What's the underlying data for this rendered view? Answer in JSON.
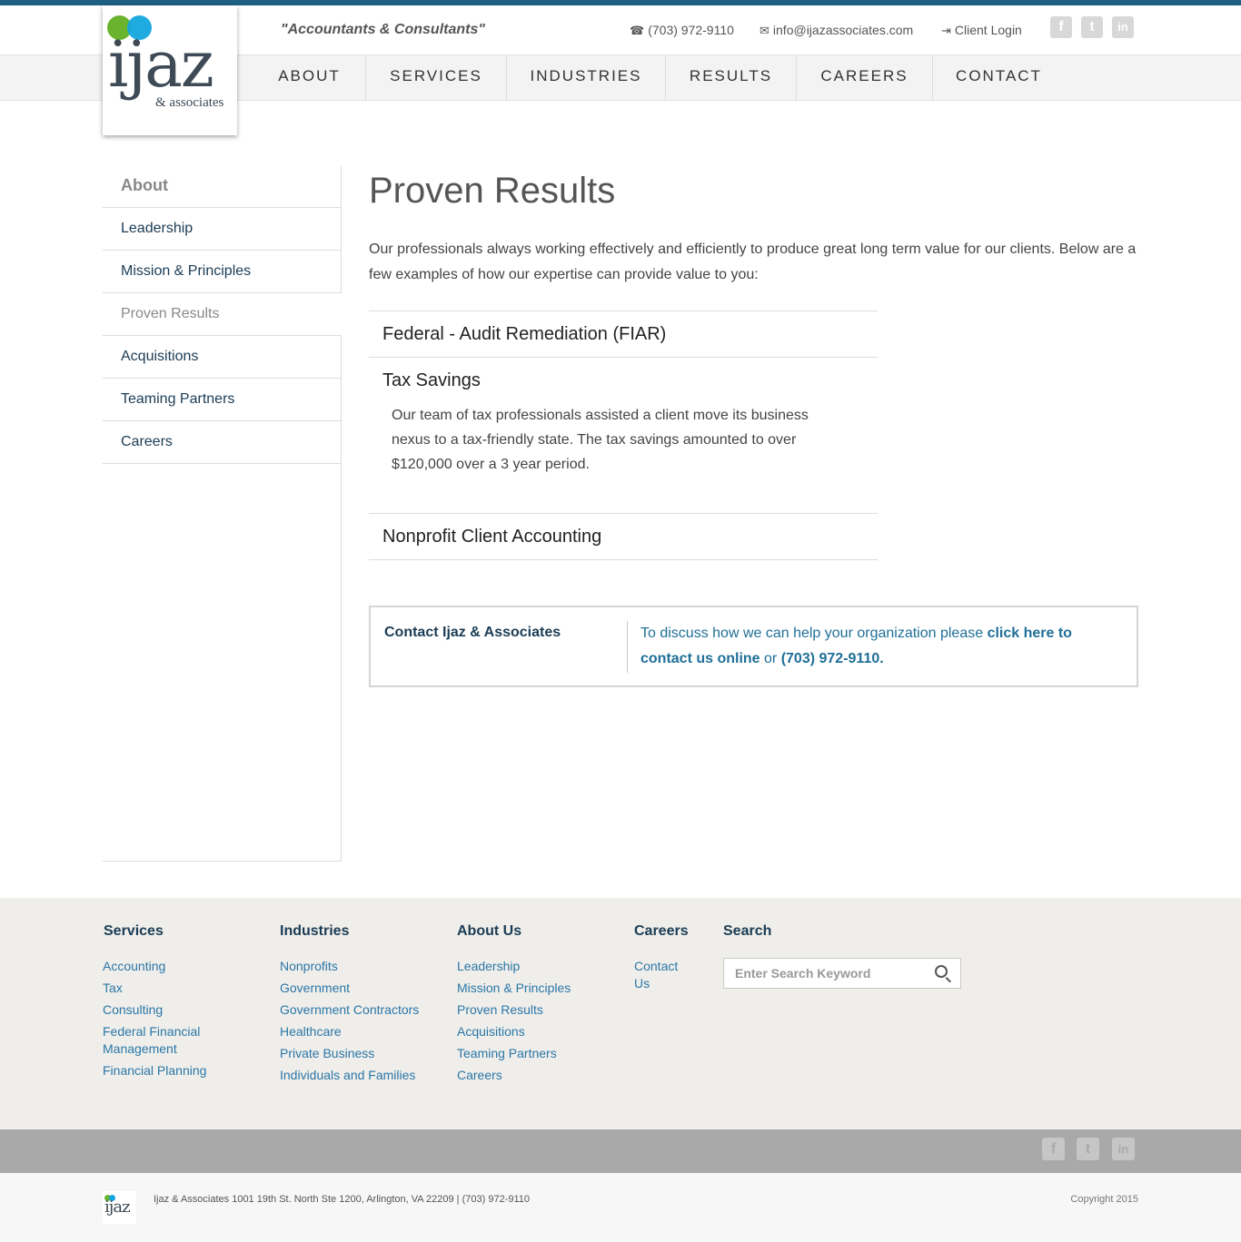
{
  "header": {
    "tagline": "\"Accountants & Consultants\"",
    "phone": "(703) 972-9110",
    "email": "info@ijazassociates.com",
    "client_login": "Client Login",
    "logo_word": "ijaz",
    "logo_sub": "& associates",
    "social": [
      "f",
      "t",
      "in"
    ]
  },
  "nav": [
    "ABOUT",
    "SERVICES",
    "INDUSTRIES",
    "RESULTS",
    "CAREERS",
    "CONTACT"
  ],
  "sidebar": {
    "title": "About",
    "items": [
      {
        "label": "Leadership"
      },
      {
        "label": "Mission & Principles"
      },
      {
        "label": "Proven Results"
      },
      {
        "label": "Acquisitions"
      },
      {
        "label": "Teaming Partners"
      },
      {
        "label": "Careers"
      }
    ]
  },
  "main": {
    "title": "Proven Results",
    "intro": "Our professionals always working effectively and efficiently to produce great long term value for our clients. Below are a few examples of how our expertise can provide value to you:",
    "accordion": [
      {
        "title": "Federal - Audit Remediation (FIAR)"
      },
      {
        "title": "Tax Savings",
        "body": "Our team of tax professionals assisted a client move its business nexus to a tax-friendly state. The tax savings amounted to over $120,000 over a 3 year period."
      },
      {
        "title": "Nonprofit Client Accounting"
      }
    ]
  },
  "cta": {
    "heading": "Contact Ijaz & Associates",
    "text_pre": "To discuss how we can help your organization please ",
    "link": "click here to contact us online",
    "text_mid": " or ",
    "phone": "(703) 972-9110."
  },
  "footer": {
    "services": {
      "title": "Services",
      "links": [
        "Accounting",
        "Tax",
        "Consulting",
        "Federal Financial Management",
        "Financial Planning"
      ]
    },
    "industries": {
      "title": "Industries",
      "links": [
        "Nonprofits",
        "Government",
        "Government Contractors",
        "Healthcare",
        "Private Business",
        "Individuals and Families"
      ]
    },
    "about": {
      "title": "About Us",
      "links": [
        "Leadership",
        "Mission & Principles",
        "Proven Results",
        "Acquisitions",
        "Teaming Partners",
        "Careers"
      ]
    },
    "careers": {
      "title": "Careers",
      "links": [
        "Contact Us"
      ]
    },
    "search": {
      "title": "Search",
      "placeholder": "Enter Search Keyword"
    }
  },
  "bottom": {
    "address": "Ijaz & Associates 1001 19th St. North Ste 1200, Arlington, VA 22209 | (703) 972-9110",
    "copyright": "Copyright 2015"
  }
}
